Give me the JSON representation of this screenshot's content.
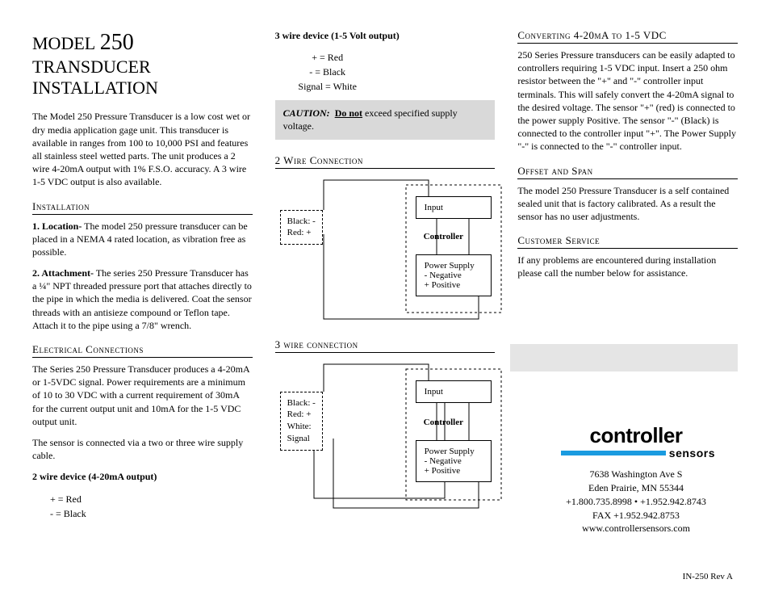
{
  "title_prefix": "MODEL",
  "title_big": "250",
  "title_line2": "TRANSDUCER",
  "title_line3": "INSTALLATION",
  "intro": "The Model 250 Pressure Transducer is a low cost wet or dry media application gage unit. This transducer is available in ranges from 100 to 10,000 PSI and features all stainless steel wetted parts. The unit produces a 2 wire 4-20mA output with 1% F.S.O. accuracy. A 3 wire 1-5 VDC output is also available.",
  "sec_install": "Installation",
  "install1_label": "1. Location-",
  "install1": " The model 250 pressure transducer can be placed in a NEMA 4 rated location, as vibration free as possible.",
  "install2_label": "2. Attachment-",
  "install2": " The series 250 Pressure Transducer has a ¼\" NPT threaded pressure port that attaches directly to the pipe in which the media is delivered. Coat the sensor threads with an antisieze compound or Teflon tape. Attach it to the pipe using a 7/8\" wrench.",
  "sec_elec": "Electrical Connections",
  "elec1": "The Series 250 Pressure Transducer produces a 4-20mA or 1-5VDC signal. Power requirements are a minimum of 10 to 30 VDC with a current requirement of 30mA for the current output unit and 10mA for the 1-5 VDC output unit.",
  "elec2": "The sensor is connected via a two or three wire supply cable.",
  "dev2_head": "2 wire device (4-20mA output)",
  "dev2_l1": "+ = Red",
  "dev2_l2": "- = Black",
  "dev3_head": "3 wire device (1-5 Volt output)",
  "dev3_l1": "+ = Red",
  "dev3_l2": "- = Black",
  "dev3_l3": "Signal = White",
  "caution_label": "CAUTION:",
  "caution_under": "Do not",
  "caution_rest": " exceed specified supply voltage.",
  "sec_2wire": "2 Wire Connection",
  "sec_3wire": "3 wire  connection",
  "sensor2_l1": "Black: -",
  "sensor2_l2": "Red: +",
  "sensor3_l1": "Black: -",
  "sensor3_l2": "Red: +",
  "sensor3_l3": "White:",
  "sensor3_l4": "Signal",
  "ctrl_input": "Input",
  "ctrl_label": "Controller",
  "ctrl_ps1": "Power Supply",
  "ctrl_ps2": "- Negative",
  "ctrl_ps3": "+ Positive",
  "sec_conv": "Converting 4-20mA to 1-5 VDC",
  "conv": "250 Series Pressure transducers can be easily adapted to controllers requiring 1-5 VDC input. Insert a 250 ohm resistor between the \"+\" and \"-\" controller input terminals. This will safely convert the 4-20mA signal to the desired voltage. The sensor \"+\" (red) is connected to the power supply Positive.  The sensor \"-\" (Black) is connected to the controller input \"+\". The Power Supply \"-\" is connected to the \"-\" controller input.",
  "sec_offset": "Offset  and Span",
  "offset": "The model 250 Pressure Transducer is a self contained sealed unit that is factory calibrated. As a result the sensor has no user adjustments.",
  "sec_cust": "Customer Service",
  "cust": "If any problems are encountered during installation please call the number below for assistance.",
  "logo1": "controller",
  "logo2": "sensors",
  "addr1": "7638 Washington Ave S",
  "addr2": "Eden Prairie, MN 55344",
  "addr3": "+1.800.735.8998 • +1.952.942.8743",
  "addr4": "FAX +1.952.942.8753",
  "addr5": "www.controllersensors.com",
  "footer": "IN-250 Rev A"
}
